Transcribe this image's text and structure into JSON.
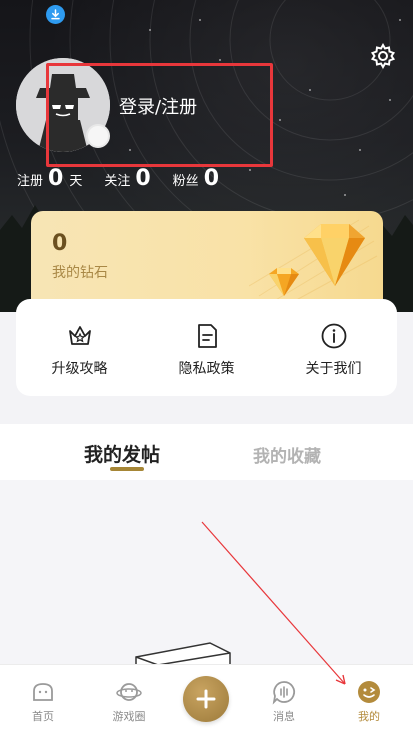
{
  "header": {
    "login_label": "登录/注册",
    "download_icon": "download-icon",
    "settings_icon": "gear-icon"
  },
  "stats": {
    "register_label": "注册",
    "register_value": "0",
    "register_unit": "天",
    "follow_label": "关注",
    "follow_value": "0",
    "fans_label": "粉丝",
    "fans_value": "0"
  },
  "diamond": {
    "value": "0",
    "label": "我的钻石"
  },
  "quick_links": [
    {
      "label": "升级攻略",
      "icon": "crown-icon"
    },
    {
      "label": "隐私政策",
      "icon": "document-icon"
    },
    {
      "label": "关于我们",
      "icon": "info-icon"
    }
  ],
  "tabs": {
    "posts": "我的发帖",
    "favorites": "我的收藏"
  },
  "bottom_nav": [
    {
      "label": "首页",
      "icon": "home-icon"
    },
    {
      "label": "游戏圈",
      "icon": "planet-icon"
    },
    {
      "label": "",
      "icon": "plus-icon"
    },
    {
      "label": "消息",
      "icon": "message-icon"
    },
    {
      "label": "我的",
      "icon": "profile-icon"
    }
  ],
  "colors": {
    "accent": "#b38b3c",
    "highlight_box": "#e8373b",
    "arrow": "#e8373b"
  }
}
